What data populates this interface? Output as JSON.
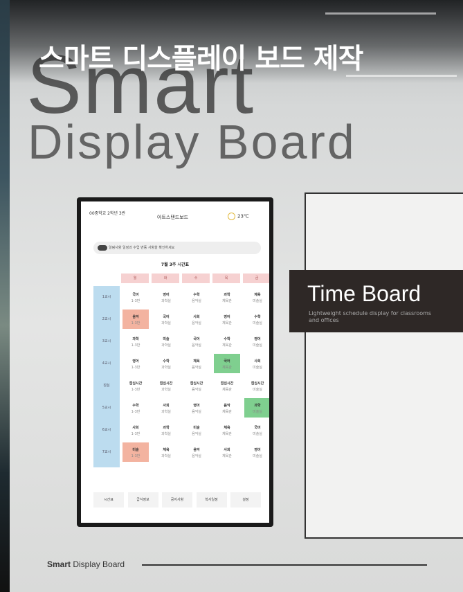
{
  "headline": "스마트 디스플레이 보드 제작",
  "title_big_1": "Smart",
  "title_big_2": "Display Board",
  "time_board": {
    "title": "Time Board",
    "subtitle": "Lightweight schedule display for classrooms and offices"
  },
  "screen": {
    "header_left": "00중학교 2학년 3반",
    "header_title": "아트스탠드보드",
    "weather": "23℃",
    "notice": "알림사항 일정과 수업 변동 사항을 확인하세요",
    "timetable_title": "7월 3주 시간표",
    "days": [
      "월",
      "화",
      "수",
      "목",
      "금"
    ],
    "periods": [
      "1교시",
      "2교시",
      "3교시",
      "4교시",
      "점심",
      "5교시",
      "6교시",
      "7교시"
    ],
    "rows": [
      [
        "국어",
        "영어",
        "수학",
        "과학",
        "체육"
      ],
      [
        "음악",
        "국어",
        "사회",
        "영어",
        "수학"
      ],
      [
        "과학",
        "미술",
        "국어",
        "수학",
        "영어"
      ],
      [
        "영어",
        "수학",
        "체육",
        "국어",
        "사회"
      ],
      [
        "점심시간",
        "점심시간",
        "점심시간",
        "점심시간",
        "점심시간"
      ],
      [
        "수학",
        "사회",
        "영어",
        "음악",
        "과학"
      ],
      [
        "사회",
        "과학",
        "미술",
        "체육",
        "국어"
      ],
      [
        "미술",
        "체육",
        "음악",
        "사회",
        "영어"
      ]
    ],
    "rooms": [
      "1-3반",
      "과학실",
      "음악실",
      "체육관",
      "미술실"
    ],
    "tabs": [
      "시간표",
      "급식정보",
      "공지사항",
      "학사일정",
      "설정"
    ]
  },
  "footer": {
    "bold": "Smart",
    "rest": " Display Board"
  },
  "colors": {
    "highlight_orange": "#f3b3a0",
    "highlight_green": "#7fcf8f",
    "day_header": "#f6d1d1",
    "period_column": "#bcdcef"
  }
}
